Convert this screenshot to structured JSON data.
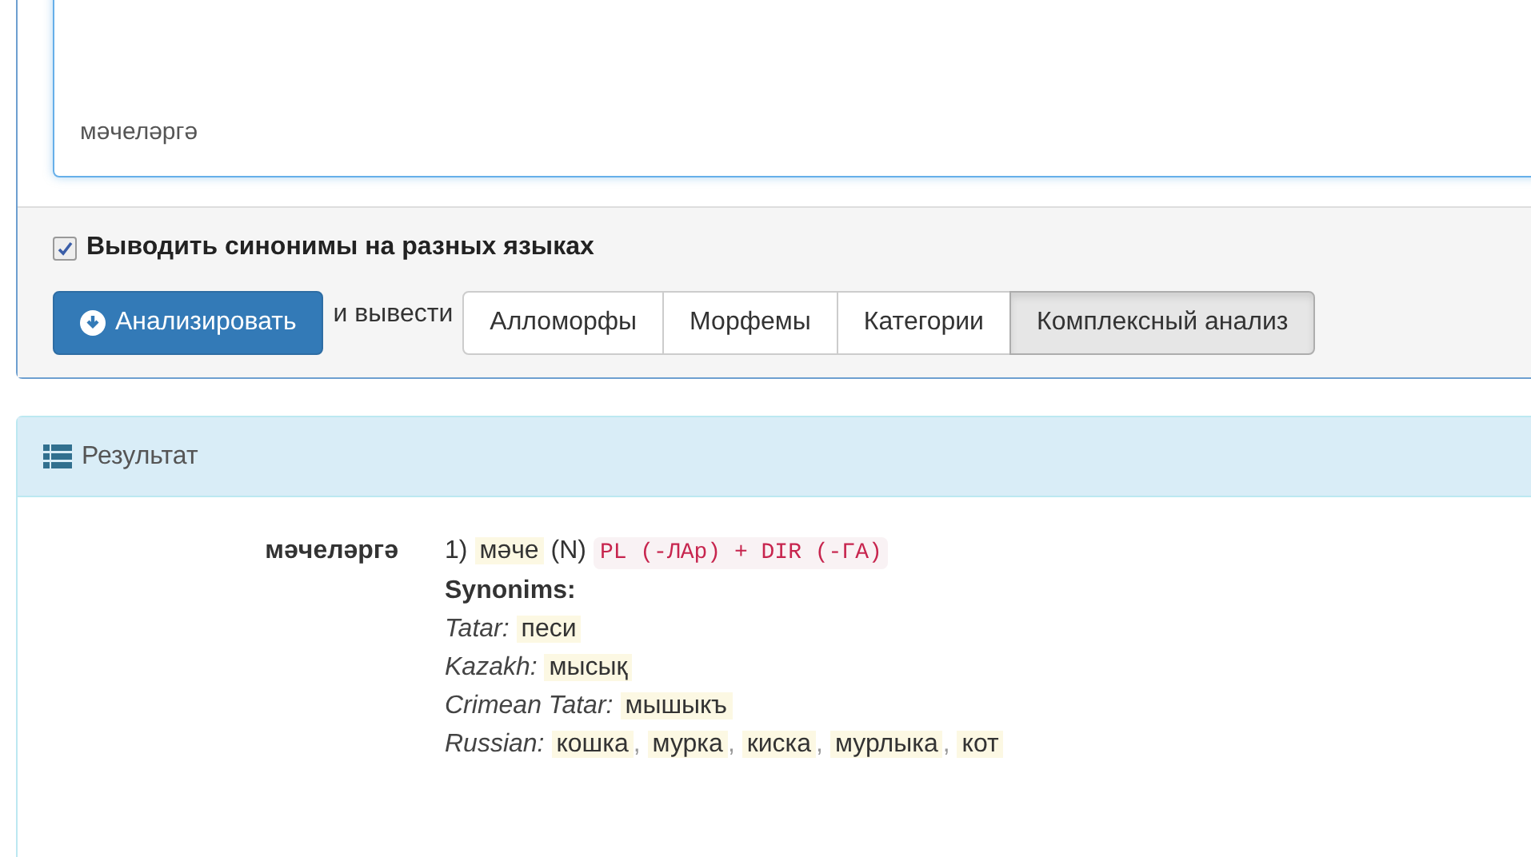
{
  "input": {
    "value": "мәчеләргә"
  },
  "synonyms_option": {
    "label": "Выводить синонимы на разных языках",
    "checked": true
  },
  "analyze_button": {
    "label": "Анализировать"
  },
  "output_label": "и вывести",
  "output_modes": [
    {
      "label": "Алломорфы",
      "selected": false
    },
    {
      "label": "Морфемы",
      "selected": false
    },
    {
      "label": "Категории",
      "selected": false
    },
    {
      "label": "Комплексный анализ",
      "selected": true
    }
  ],
  "result": {
    "title": "Результат",
    "separator": ",",
    "entries": [
      {
        "word": "мәчеләргә",
        "analyses": [
          {
            "number": "1)",
            "lemma": "мәче",
            "pos": "(N)",
            "tags": "PL (-ЛАр) + DIR (-ГА)",
            "synonyms_heading": "Synonims:",
            "synonyms": [
              {
                "language": "Tatar:",
                "words": [
                  "песи"
                ]
              },
              {
                "language": "Kazakh:",
                "words": [
                  "мысық"
                ]
              },
              {
                "language": "Crimean Tatar:",
                "words": [
                  "мышыкъ"
                ]
              },
              {
                "language": "Russian:",
                "words": [
                  "кошка",
                  "мурка",
                  "киска",
                  "мурлыка",
                  "кот"
                ]
              }
            ]
          }
        ]
      }
    ]
  }
}
